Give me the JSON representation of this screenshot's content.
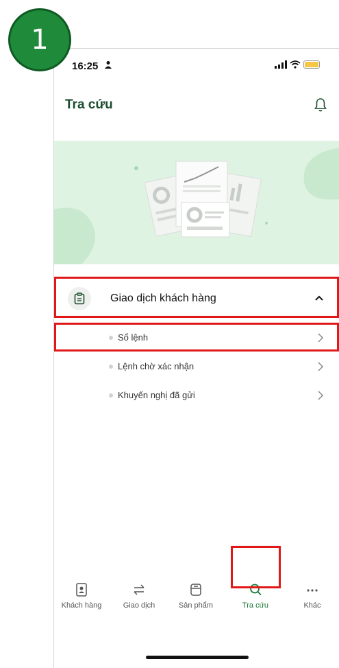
{
  "step_badge": "1",
  "status_bar": {
    "time": "16:25",
    "person_icon": "person-icon",
    "signal_icon": "signal-icon",
    "wifi_icon": "wifi-icon",
    "battery_icon": "battery-icon"
  },
  "header": {
    "title": "Tra cứu",
    "bell_icon": "bell-icon"
  },
  "menu": {
    "group_label": "Giao dịch khách hàng",
    "group_icon": "clipboard-icon",
    "expanded": true,
    "items": [
      {
        "label": "Sổ lệnh"
      },
      {
        "label": "Lệnh chờ xác nhận"
      },
      {
        "label": "Khuyến nghị đã gửi"
      }
    ]
  },
  "tabs": [
    {
      "label": "Khách hàng",
      "icon": "customer-icon",
      "active": false
    },
    {
      "label": "Giao dịch",
      "icon": "transfer-icon",
      "active": false
    },
    {
      "label": "Sản phẩm",
      "icon": "product-icon",
      "active": false
    },
    {
      "label": "Tra cứu",
      "icon": "search-icon",
      "active": true
    },
    {
      "label": "Khác",
      "icon": "more-icon",
      "active": false
    }
  ],
  "colors": {
    "accent": "#1c7a3a",
    "title": "#1c4d2c",
    "highlight": "#e01818",
    "banner_bg": "#dff3e3",
    "badge": "#1f8a3a"
  }
}
